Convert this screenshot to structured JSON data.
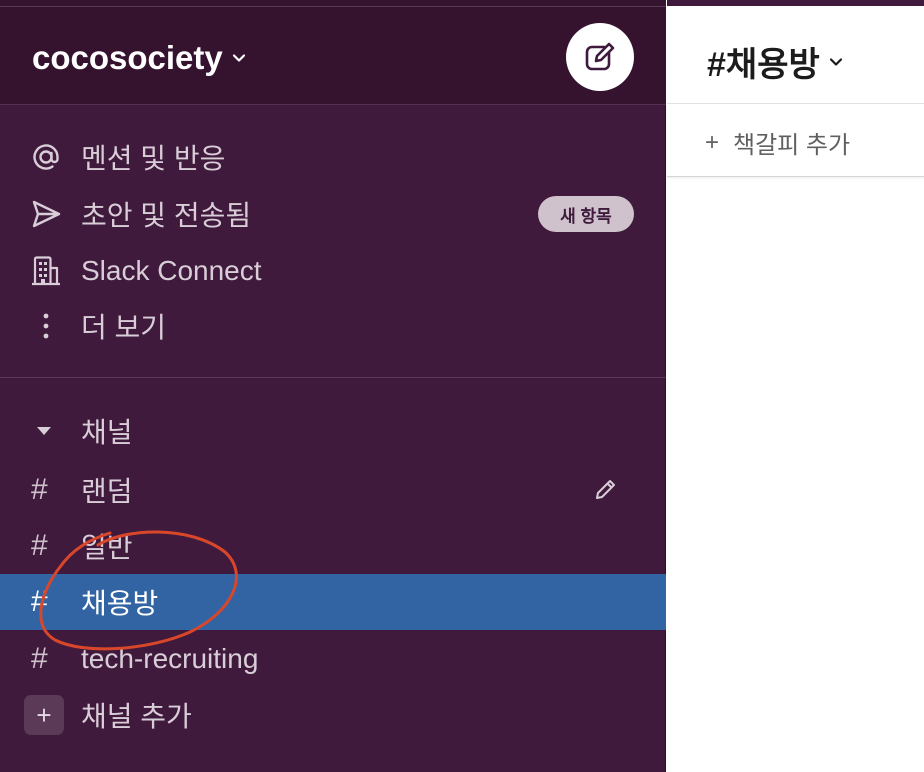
{
  "workspace": {
    "name": "cocosociety",
    "compose_icon": "compose-icon"
  },
  "nav": {
    "items": [
      {
        "label": "멘션 및 반응",
        "icon": "at-icon"
      },
      {
        "label": "초안 및 전송됨",
        "icon": "send-icon",
        "badge": "새 항목"
      },
      {
        "label": "Slack Connect",
        "icon": "building-icon"
      },
      {
        "label": "더 보기",
        "icon": "more-vertical-icon"
      }
    ]
  },
  "channels": {
    "section_label": "채널",
    "items": [
      {
        "label": "랜덤"
      },
      {
        "label": "일반"
      },
      {
        "label": "채용방",
        "active": true
      },
      {
        "label": "tech-recruiting"
      }
    ],
    "add_label": "채널 추가",
    "add_symbol": "+"
  },
  "main": {
    "channel_title": "#채용방",
    "bookmark_add": "책갈피 추가",
    "bookmark_symbol": "+"
  },
  "colors": {
    "sidebar": "#3f1a3c",
    "active": "#3264a4",
    "annotation": "#d9472b"
  }
}
